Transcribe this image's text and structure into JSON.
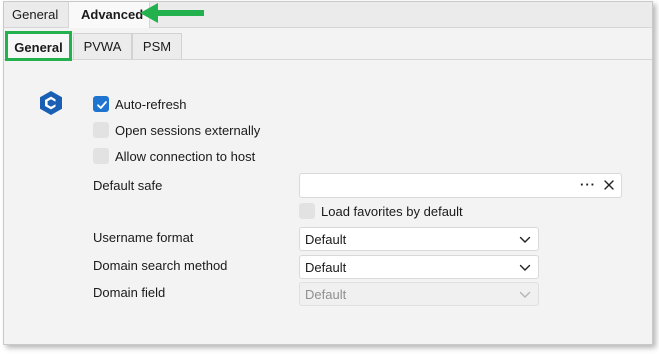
{
  "top_tabs": [
    "General",
    "Advanced"
  ],
  "active_top_tab": "Advanced",
  "sub_tabs": [
    "General",
    "PVWA",
    "PSM"
  ],
  "active_sub_tab": "General",
  "options": {
    "auto_refresh": {
      "label": "Auto-refresh",
      "checked": true
    },
    "open_sessions_externally": {
      "label": "Open sessions externally",
      "checked": false
    },
    "allow_connection_to_host": {
      "label": "Allow connection to host",
      "checked": false
    }
  },
  "default_safe": {
    "label": "Default safe",
    "value": "",
    "browse_label": "···"
  },
  "load_favorites": {
    "label": "Load favorites by default",
    "checked": false
  },
  "username_format": {
    "label": "Username format",
    "value": "Default"
  },
  "domain_search_method": {
    "label": "Domain search method",
    "value": "Default"
  },
  "domain_field": {
    "label": "Domain field",
    "value": "Default",
    "disabled": true
  },
  "colors": {
    "accent": "#1f74d0",
    "highlight": "#22b14c",
    "logo": "#1a5fb4"
  },
  "icons": [
    "app-logo-icon",
    "checkmark-icon",
    "clear-icon",
    "chevron-down-icon",
    "annotation-arrow-icon"
  ]
}
